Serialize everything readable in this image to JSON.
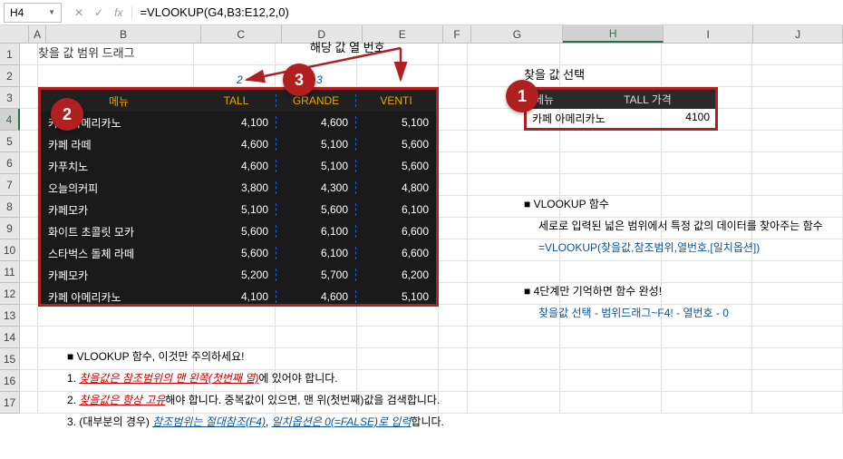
{
  "nameBox": "H4",
  "formula": "=VLOOKUP(G4,B3:E12,2,0)",
  "columns": [
    "A",
    "B",
    "C",
    "D",
    "E",
    "F",
    "G",
    "H",
    "I",
    "J"
  ],
  "rows": [
    "1",
    "2",
    "3",
    "4",
    "5",
    "6",
    "7",
    "8",
    "9",
    "10",
    "11",
    "12",
    "13",
    "14",
    "15",
    "16",
    "17"
  ],
  "overflowNote": "찾을 값 범위 드래그",
  "colNums": {
    "c": "2",
    "d": "3"
  },
  "arrowLabel": "해당 값 열 번호",
  "darkTable": {
    "head": {
      "b": "메뉴",
      "c": "TALL",
      "d": "GRANDE",
      "e": "VENTI"
    },
    "rows": [
      {
        "b": "카페 아메리카노",
        "c": "4,100",
        "d": "4,600",
        "e": "5,100"
      },
      {
        "b": "카페 라떼",
        "c": "4,600",
        "d": "5,100",
        "e": "5,600"
      },
      {
        "b": "카푸치노",
        "c": "4,600",
        "d": "5,100",
        "e": "5,600"
      },
      {
        "b": "오늘의커피",
        "c": "3,800",
        "d": "4,300",
        "e": "4,800"
      },
      {
        "b": "카페모카",
        "c": "5,100",
        "d": "5,600",
        "e": "6,100"
      },
      {
        "b": "화이트 초콜릿 모카",
        "c": "5,600",
        "d": "6,100",
        "e": "6,600"
      },
      {
        "b": "스타벅스 돌체 라떼",
        "c": "5,600",
        "d": "6,100",
        "e": "6,600"
      },
      {
        "b": "카페모카",
        "c": "5,200",
        "d": "5,700",
        "e": "6,200"
      },
      {
        "b": "카페 아메리카노",
        "c": "4,100",
        "d": "4,600",
        "e": "5,100"
      }
    ]
  },
  "lookup": {
    "title": "찾을 값 선택",
    "head": {
      "menu": "메뉴",
      "price": "TALL 가격"
    },
    "row": {
      "menu": "카페 아메리카노",
      "price": "4100"
    }
  },
  "info1": {
    "hdr": "■ VLOOKUP 함수",
    "l1": "세로로 입력된 넓은 범위에서 특정 값의 데이터를 찾아주는 함수",
    "l2": "=VLOOKUP(찾을값,참조범위,열번호,[일치옵션])"
  },
  "info2": {
    "hdr": "■ 4단계만 기억하면 함수 완성!",
    "l1": "찾을값 선택 - 범위드래그~F4! - 열번호 - 0"
  },
  "notes": {
    "hdr": "■ VLOOKUP 함수, 이것만 주의하세요!",
    "n1a": "1. ",
    "n1b": "찾을값은 참조범위의 맨 왼쪽(첫번째 열)",
    "n1c": "에 있어야 합니다.",
    "n2a": "2. ",
    "n2b": "찾을값은 항상 고유",
    "n2c": "해야 합니다. 중복값이 있으면, 맨 위(첫번째)값을 검색합니다.",
    "n3a": "3. (대부분의 경우) ",
    "n3b": "참조범위는 절대참조(F4)",
    "n3c": ",  ",
    "n3d": "일치옵션은 0(=FALSE)로 입력",
    "n3e": "합니다."
  },
  "circles": {
    "c1": "1",
    "c2": "2",
    "c3": "3"
  }
}
